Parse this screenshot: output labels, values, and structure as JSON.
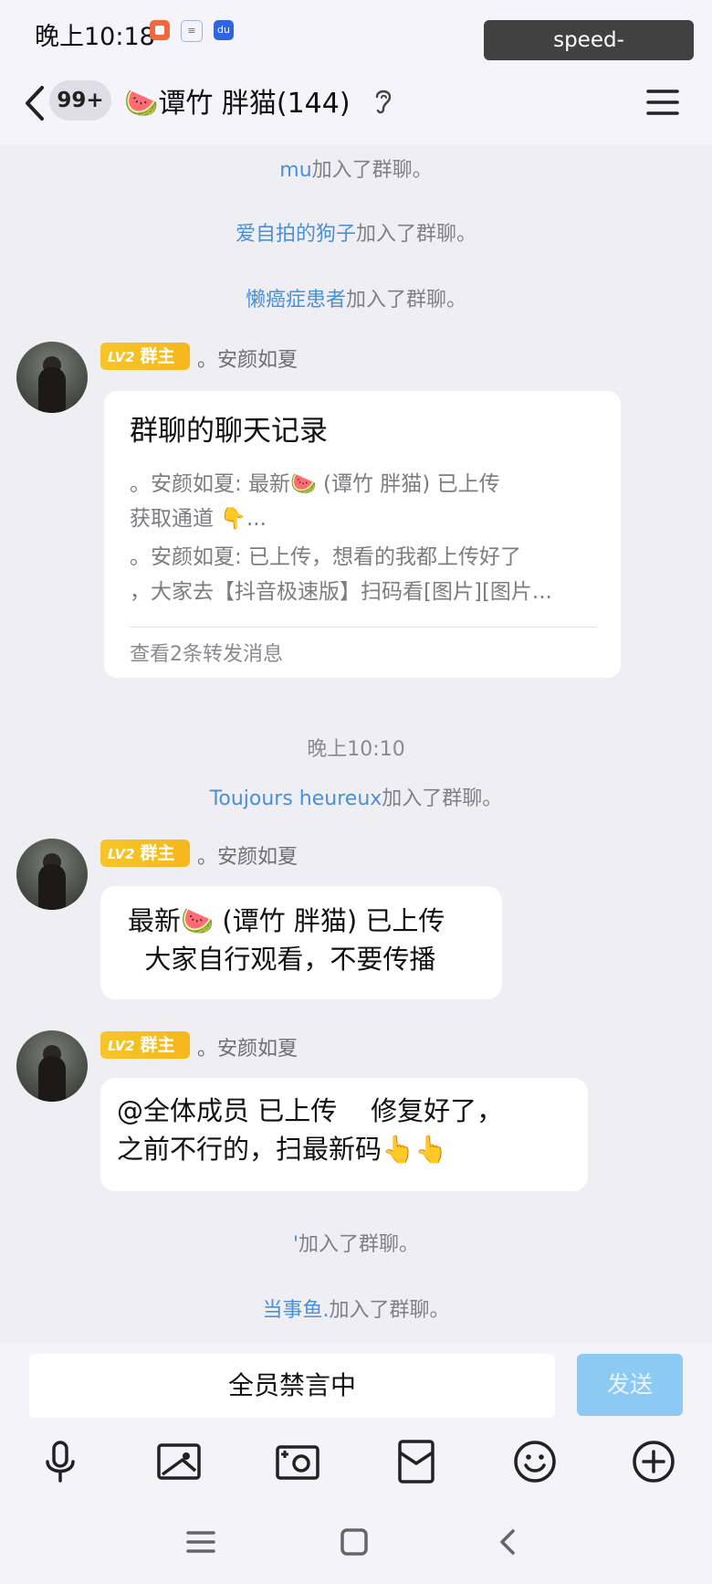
{
  "status_bar": {
    "time": "晚上10:18",
    "watermark": "speed-guanjing.com"
  },
  "header": {
    "unread_badge": "99+",
    "title": "🍉谭竹  胖猫(144)"
  },
  "system_messages": [
    {
      "name": "mu",
      "text": "加入了群聊。"
    },
    {
      "name": "爱自拍的狗子",
      "text": "加入了群聊。"
    },
    {
      "name": "懒癌症患者",
      "text": "加入了群聊。"
    }
  ],
  "time_divider": "晚上10:10",
  "system_message_mid": {
    "name": "Toujours heureux",
    "text": "加入了群聊。"
  },
  "system_messages_bottom": [
    {
      "name": "'",
      "text": "加入了群聊。"
    },
    {
      "name": "当事鱼.",
      "text": "加入了群聊。"
    }
  ],
  "messages": [
    {
      "level": "LV2",
      "role": "群主",
      "sender": "。安颜如夏",
      "forward_card": {
        "title": "群聊的聊天记录",
        "lines": [
          "。安颜如夏: 最新🍉 (谭竹 胖猫) 已上传",
          "   获取通道 👇...",
          "。安颜如夏: 已上传，想看的我都上传好了",
          "，大家去【抖音极速版】扫码看[图片][图片..."
        ],
        "footer": "查看2条转发消息"
      }
    },
    {
      "level": "LV2",
      "role": "群主",
      "sender": "。安颜如夏",
      "lines": [
        "最新🍉 (谭竹 胖猫) 已上传",
        "  大家自行观看，不要传播"
      ]
    },
    {
      "level": "LV2",
      "role": "群主",
      "sender": "。安颜如夏",
      "lines": [
        "@全体成员 已上传    修复好了，",
        "之前不行的，扫最新码👆👆"
      ]
    }
  ],
  "input_bar": {
    "muted_text": "全员禁言中",
    "send_label": "发送"
  },
  "toolbar_icons": [
    "microphone-icon",
    "image-icon",
    "camera-icon",
    "red-packet-icon",
    "emoji-icon",
    "plus-icon"
  ],
  "nav_icons": [
    "menu-icon",
    "home-icon",
    "back-icon"
  ]
}
